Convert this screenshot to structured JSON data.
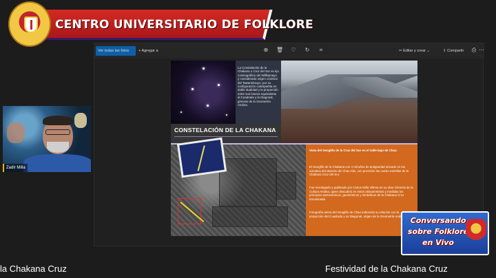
{
  "banner": {
    "title": "CENTRO UNIVERSITARIO DE FOLKLORE",
    "seal_icon": "university-seal-icon"
  },
  "viewer": {
    "toolbar": {
      "view_all": "Ver todas las fotos",
      "add_to": "Agregar a",
      "edit_create": "Editar y crear",
      "share": "Compartir",
      "icons": [
        "zoom-icon",
        "delete-icon",
        "favorite-icon",
        "rotate-icon",
        "crop-icon",
        "more-icon",
        "print-icon"
      ]
    }
  },
  "slide": {
    "constellation_text": "La Constelación de la Chakana o Cruz del Sur es ejo cosmográfico del Willkamayo y considerado origen cósmico del Tawantinsuyo, por su configuración cuatripartita en doble dualidad y la proporción entre sus brazos equivalente al Cuadrado y la Diagonal, génesis de la Geometría Andina.",
    "title": "CONSTELACIÓN DE LA CHAKANA",
    "orange_p1": "Vista del Geoglifo de la Cruz del Sur en el Valle bajo de Chao.",
    "orange_p2": "El Geoglifo de la Chakana con 4 mil años de antigüedad ubicado en los arenales del desierto de Chao Alto, con precisión las cuatro estrellas de la Chakana Cruz del Sur.",
    "orange_p3": "Fue investigado y publicado por Carlos Milla Villena en su obra Génesis de la Cultura Andina, quien descubrió en estos alineamientos y medidas los principios astronómicos, geométricos y simbólicos de la Chakana Cruz Escalonada.",
    "orange_p4": "Fotografía aérea del Geoglifo de Chao indicando su relación con la proporción del Cuadrado y su Diagonal, origen de la Geometría Andina."
  },
  "webcam": {
    "name": "Zadir Milla"
  },
  "logo": {
    "line1": "Conversando",
    "line2": "sobre Folklore",
    "line3": "en Vivo"
  },
  "captions": {
    "left": "la Chakana Cruz",
    "right": "Festividad de la Chakana Cruz"
  }
}
